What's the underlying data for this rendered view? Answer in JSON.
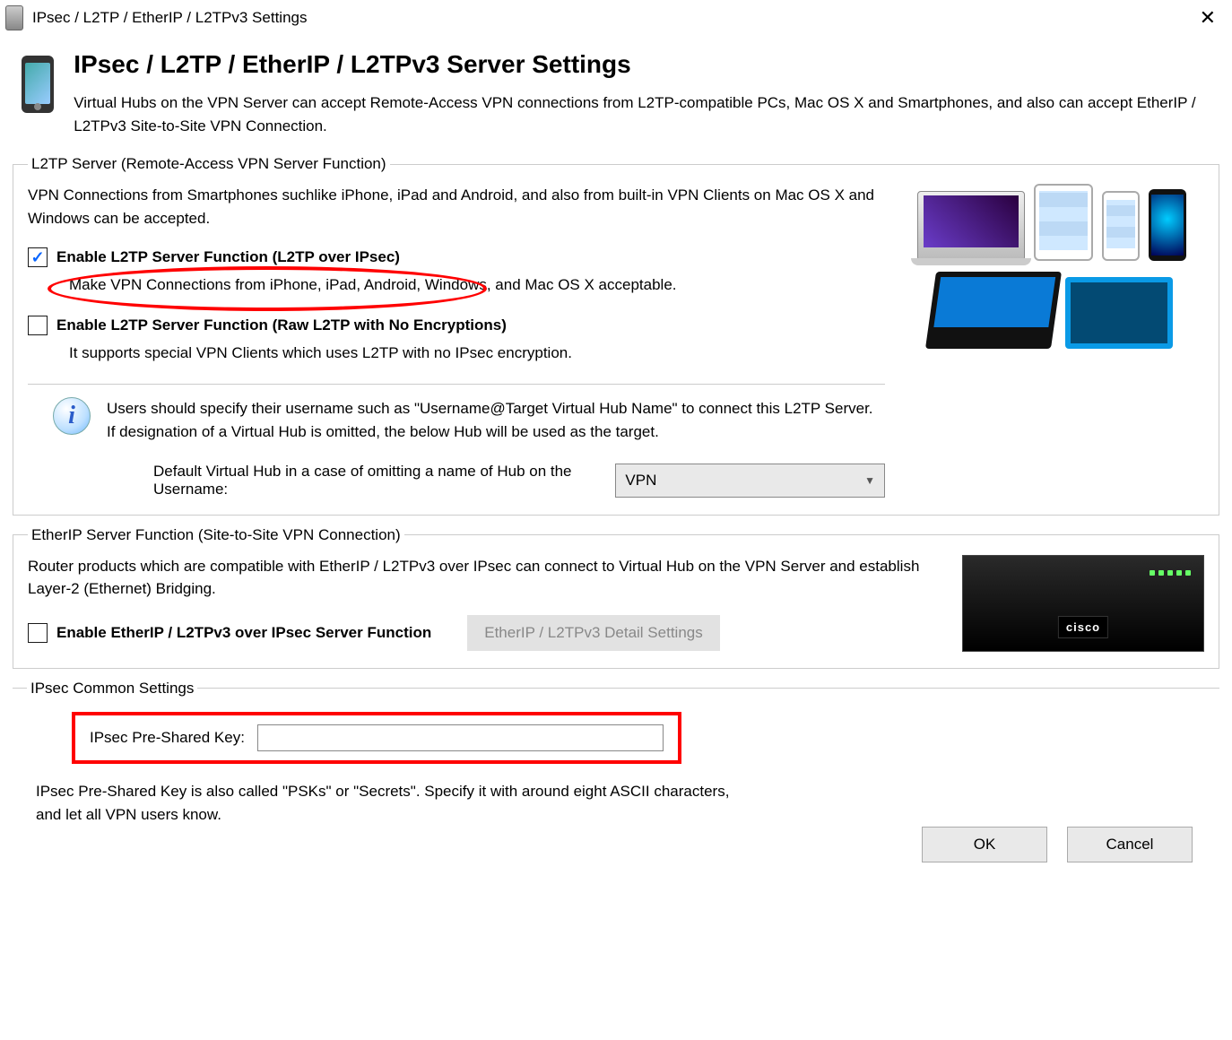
{
  "titlebar": {
    "title": "IPsec / L2TP / EtherIP / L2TPv3 Settings"
  },
  "header": {
    "title": "IPsec / L2TP / EtherIP / L2TPv3 Server Settings",
    "subtitle": "Virtual Hubs on the VPN Server can accept Remote-Access VPN connections from L2TP-compatible PCs, Mac OS X and Smartphones, and also can accept EtherIP / L2TPv3 Site-to-Site VPN Connection."
  },
  "l2tp": {
    "legend": "L2TP Server (Remote-Access VPN Server Function)",
    "intro": "VPN Connections from Smartphones suchlike iPhone, iPad and Android, and also from built-in VPN Clients on Mac OS X and Windows can be accepted.",
    "enable_ipsec": {
      "label": "Enable L2TP Server Function (L2TP over IPsec)",
      "checked": true,
      "desc": "Make VPN Connections from iPhone, iPad, Android, Windows, and Mac OS X acceptable."
    },
    "enable_raw": {
      "label": "Enable L2TP Server Function (Raw L2TP with No Encryptions)",
      "checked": false,
      "desc": "It supports special VPN Clients which uses L2TP with no IPsec encryption."
    },
    "info_line1": "Users should specify their username such as \"Username@Target Virtual Hub Name\" to connect this L2TP Server.",
    "info_line2": "If designation of a Virtual Hub is omitted, the below Hub will be used as the target.",
    "hub_label": "Default Virtual Hub in a case of omitting a name of Hub on the Username:",
    "hub_value": "VPN"
  },
  "etherip": {
    "legend": "EtherIP Server Function (Site-to-Site VPN Connection)",
    "desc": "Router products which are compatible with EtherIP / L2TPv3 over IPsec can connect to Virtual Hub on the VPN Server and establish Layer-2 (Ethernet) Bridging.",
    "enable": {
      "label": "Enable EtherIP / L2TPv3 over IPsec Server Function",
      "checked": false
    },
    "detail_button": "EtherIP / L2TPv3 Detail Settings"
  },
  "ipsec": {
    "legend": "IPsec Common Settings",
    "psk_label": "IPsec Pre-Shared Key:",
    "psk_value": "",
    "note": "IPsec Pre-Shared Key is also called \"PSKs\" or \"Secrets\". Specify it with around eight ASCII characters, and let all VPN users know."
  },
  "buttons": {
    "ok": "OK",
    "cancel": "Cancel"
  }
}
